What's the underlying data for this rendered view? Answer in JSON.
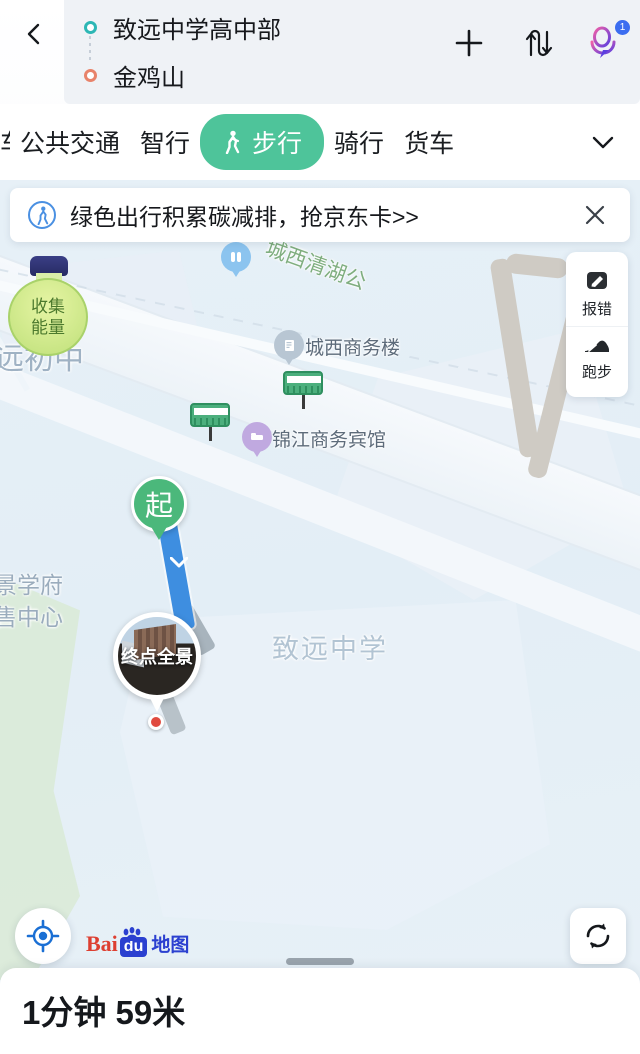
{
  "header": {
    "back_icon": "chevron-left-icon",
    "route": {
      "start_label": "致远中学高中部",
      "end_label": "金鸡山",
      "start_dot_color": "#2db7b5",
      "end_dot_color": "#e8836b"
    },
    "actions": [
      {
        "name": "add-waypoint-button",
        "icon": "plus-icon"
      },
      {
        "name": "swap-endpoints-button",
        "icon": "swap-arrows-icon"
      },
      {
        "name": "voice-assistant-button",
        "icon": "voice-assistant-icon",
        "badge": "1"
      }
    ]
  },
  "tabs": {
    "items": [
      {
        "label": "车",
        "active": false,
        "cut": true
      },
      {
        "label": "公共交通",
        "active": false
      },
      {
        "label": "智行",
        "active": false
      },
      {
        "label": "步行",
        "active": true,
        "icon": "walking-icon"
      },
      {
        "label": "骑行",
        "active": false
      },
      {
        "label": "货车",
        "active": false
      }
    ],
    "expand_icon": "chevron-down-icon",
    "active_color": "#4ec49a"
  },
  "banner": {
    "icon": "walking-badge-icon",
    "text": "绿色出行积累碳减排，抢京东卡>>",
    "close_icon": "close-icon"
  },
  "side_panel": {
    "items": [
      {
        "label": "报错",
        "icon": "pencil-report-icon"
      },
      {
        "label": "跑步",
        "icon": "running-shoe-icon"
      }
    ]
  },
  "energy_bubble": {
    "line1": "收集",
    "line2": "能量"
  },
  "map": {
    "labels": [
      {
        "text": "城西清湖公",
        "name": "map-label-chengxi-qinghu-park"
      },
      {
        "text": "城西商务楼",
        "name": "map-label-chengxi-business-building"
      },
      {
        "text": "锦江商务宾馆",
        "name": "map-label-jinjiang-business-hotel"
      },
      {
        "text": "远初中",
        "name": "map-label-yuan-middle-school"
      },
      {
        "text": "景学府",
        "name": "map-label-jing-xuefu"
      },
      {
        "text": "售中心",
        "name": "map-label-sales-center"
      },
      {
        "text": "致远中学",
        "name": "map-label-zhiyuan-middle-school"
      }
    ],
    "start_marker": "起",
    "panorama_label": "终点全景"
  },
  "controls": {
    "locate_icon": "locate-crosshair-icon",
    "refresh_icon": "refresh-icon",
    "brand": {
      "bai": "Bai",
      "du": "du",
      "ditu": "地图"
    }
  },
  "sheet": {
    "summary": "1分钟  59米"
  }
}
